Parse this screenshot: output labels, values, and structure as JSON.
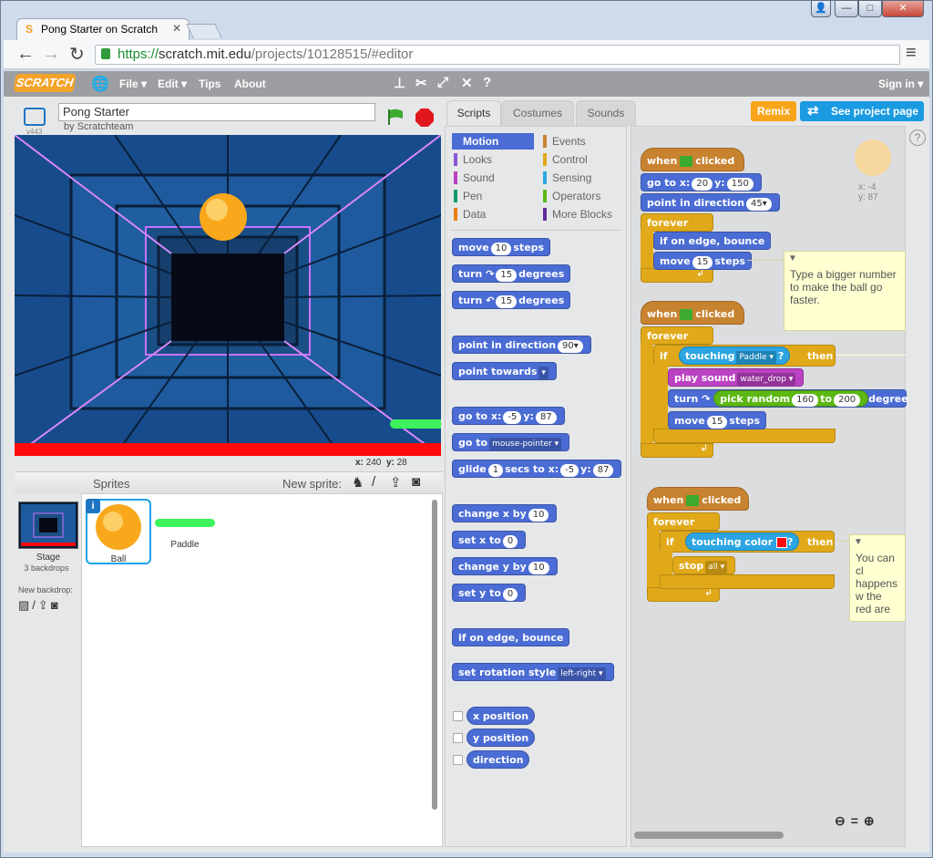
{
  "browser": {
    "tab_title": "Pong Starter on Scratch",
    "url_scheme": "https://",
    "url_host": "scratch.mit.edu",
    "url_path": "/projects/10128515/#editor"
  },
  "menubar": {
    "logo": "SCRATCH",
    "file": "File ▾",
    "edit": "Edit ▾",
    "tips": "Tips",
    "about": "About",
    "signin": "Sign in ▾"
  },
  "stage_header": {
    "version": "v443",
    "title_value": "Pong Starter",
    "byline": "by Scratchteam"
  },
  "stage_readout": {
    "x_label": "x:",
    "x": "240",
    "y_label": "y:",
    "y": "28"
  },
  "sprites_panel": {
    "header": "Sprites",
    "new_sprite": "New sprite:",
    "stage_label": "Stage",
    "backdrops": "3 backdrops",
    "new_backdrop": "New backdrop:",
    "sprites": [
      {
        "name": "Ball"
      },
      {
        "name": "Paddle"
      }
    ]
  },
  "tabs": {
    "scripts": "Scripts",
    "costumes": "Costumes",
    "sounds": "Sounds"
  },
  "actions": {
    "remix": "Remix",
    "see_page": "See project page"
  },
  "categories": {
    "left": [
      "Motion",
      "Looks",
      "Sound",
      "Pen",
      "Data"
    ],
    "right": [
      "Events",
      "Control",
      "Sensing",
      "Operators",
      "More Blocks"
    ]
  },
  "palette": {
    "move": [
      "move",
      "10",
      "steps"
    ],
    "turn_right": [
      "turn",
      "15",
      "degrees"
    ],
    "turn_left": [
      "turn",
      "15",
      "degrees"
    ],
    "point_dir": [
      "point in direction",
      "90▾"
    ],
    "point_towards": [
      "point towards",
      "▾"
    ],
    "goto_xy": [
      "go to x:",
      "-5",
      "y:",
      "87"
    ],
    "goto": [
      "go to",
      "mouse-pointer ▾"
    ],
    "glide": [
      "glide",
      "1",
      "secs to x:",
      "-5",
      "y:",
      "87"
    ],
    "change_x": [
      "change x by",
      "10"
    ],
    "set_x": [
      "set x to",
      "0"
    ],
    "change_y": [
      "change y by",
      "10"
    ],
    "set_y": [
      "set y to",
      "0"
    ],
    "edge": "if on edge, bounce",
    "rotation": [
      "set rotation style",
      "left-right ▾"
    ],
    "reporters": [
      "x position",
      "y position",
      "direction"
    ]
  },
  "script1": {
    "hat": [
      "when",
      "clicked"
    ],
    "goto": [
      "go to x:",
      "20",
      "y:",
      "150"
    ],
    "point": [
      "point in direction",
      "45▾"
    ],
    "forever": "forever",
    "edge": "if on edge, bounce",
    "move": [
      "move",
      "15",
      "steps"
    ]
  },
  "script2": {
    "hat": [
      "when",
      "clicked"
    ],
    "forever": "forever",
    "if": "if",
    "touching": [
      "touching",
      "Paddle ▾",
      "?"
    ],
    "then": "then",
    "play": [
      "play sound",
      "water_drop ▾"
    ],
    "turn": [
      "turn",
      "pick random",
      "160",
      "to",
      "200",
      "degree"
    ],
    "move": [
      "move",
      "15",
      "steps"
    ]
  },
  "script3": {
    "hat": [
      "when",
      "clicked"
    ],
    "forever": "forever",
    "if": "if",
    "touching_color": [
      "touching color",
      "?"
    ],
    "then": "then",
    "stop": [
      "stop",
      "all ▾"
    ]
  },
  "notes": {
    "note1": "Type a bigger number to make the ball go faster.",
    "note2": "You can cl happens w the red are"
  },
  "sprite_info": {
    "x": "x: -4",
    "y": "y: 87"
  },
  "colors": {
    "motion": "#4a6cd4",
    "events": "#c88330",
    "control": "#e1a91a",
    "sound": "#bb42c3",
    "sensing": "#2ca5e2",
    "operators": "#5cb712",
    "looks": "#8a55d7",
    "pen": "#0e9a6c",
    "data": "#ee7d16",
    "more": "#632d99",
    "remix": "#f9a51b",
    "see_page": "#1a9ae0"
  }
}
